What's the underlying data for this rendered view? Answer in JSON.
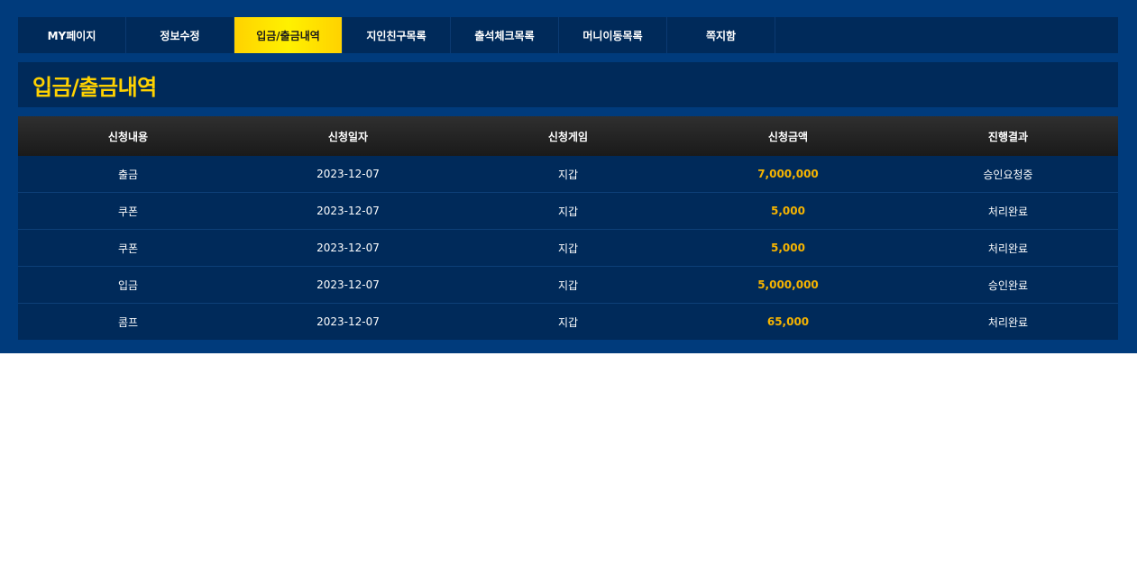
{
  "tabs": [
    {
      "label": "MY페이지"
    },
    {
      "label": "정보수정"
    },
    {
      "label": "입금/출금내역",
      "active": true
    },
    {
      "label": "지인친구목록"
    },
    {
      "label": "출석체크목록"
    },
    {
      "label": "머니이동목록"
    },
    {
      "label": "쪽지함"
    }
  ],
  "page": {
    "title": "입금/출금내역"
  },
  "table": {
    "columns": [
      "신청내용",
      "신청일자",
      "신청게임",
      "신청금액",
      "진행결과"
    ],
    "rows": [
      [
        "출금",
        "2023-12-07",
        "지갑",
        "7,000,000",
        "승인요청중"
      ],
      [
        "쿠폰",
        "2023-12-07",
        "지갑",
        "5,000",
        "처리완료"
      ],
      [
        "쿠폰",
        "2023-12-07",
        "지갑",
        "5,000",
        "처리완료"
      ],
      [
        "입금",
        "2023-12-07",
        "지갑",
        "5,000,000",
        "승인완료"
      ],
      [
        "콤프",
        "2023-12-07",
        "지갑",
        "65,000",
        "처리완료"
      ]
    ]
  },
  "colors": {
    "accent": "#ffd200",
    "amount": "#f6b400",
    "panel": "#003b7c",
    "surface": "#002a5a"
  }
}
